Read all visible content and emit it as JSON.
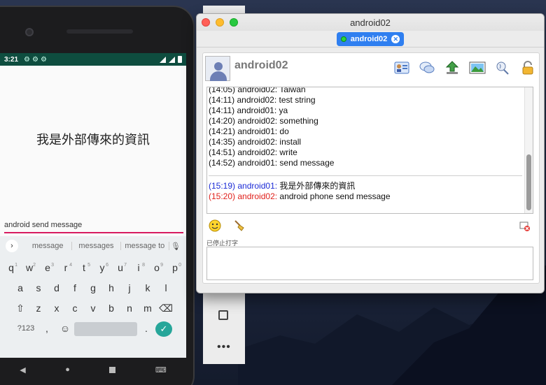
{
  "phone": {
    "status_time": "3:21",
    "app_message": "我是外部傳來的資訊",
    "input_text": "android send message",
    "suggestions": [
      "message",
      "messages",
      "message to"
    ],
    "keys_row1": [
      [
        "q",
        "1"
      ],
      [
        "w",
        "2"
      ],
      [
        "e",
        "3"
      ],
      [
        "r",
        "4"
      ],
      [
        "t",
        "5"
      ],
      [
        "y",
        "6"
      ],
      [
        "u",
        "7"
      ],
      [
        "i",
        "8"
      ],
      [
        "o",
        "9"
      ],
      [
        "p",
        "0"
      ]
    ],
    "keys_row2": [
      "a",
      "s",
      "d",
      "f",
      "g",
      "h",
      "j",
      "k",
      "l"
    ],
    "keys_row3": [
      "z",
      "x",
      "c",
      "v",
      "b",
      "n",
      "m"
    ],
    "key_symbols": "?123",
    "key_comma": ",",
    "key_period": "."
  },
  "window": {
    "title": "android02",
    "tab_label": "android02",
    "contact_name": "android02",
    "history": [
      {
        "time": "(14:05)",
        "sender": "android02",
        "text": "Taiwan"
      },
      {
        "time": "(14:11)",
        "sender": "android02",
        "text": "test string"
      },
      {
        "time": "(14:11)",
        "sender": "android01",
        "text": "ya"
      },
      {
        "time": "(14:20)",
        "sender": "android02",
        "text": "something"
      },
      {
        "time": "(14:21)",
        "sender": "android01",
        "text": "do"
      },
      {
        "time": "(14:35)",
        "sender": "android02",
        "text": "install"
      },
      {
        "time": "(14:51)",
        "sender": "android02",
        "text": "write"
      },
      {
        "time": "(14:52)",
        "sender": "android01",
        "text": "send message"
      }
    ],
    "recent": [
      {
        "time": "(15:19)",
        "sender": "android01",
        "text": "我是外部傳來的資訊",
        "color": "#1b2bd6"
      },
      {
        "time": "(15:20)",
        "sender": "android02",
        "text": "android phone send message",
        "color": "#e0201b"
      }
    ],
    "typing_status": "已停止打字"
  },
  "colors": {
    "tab_blue": "#2f7ff0",
    "sent_blue": "#1b2bd6",
    "received_red": "#e0201b",
    "android_statusbar": "#0e4d3f",
    "input_underline": "#d81b60"
  },
  "icons": [
    "contact-card-icon",
    "chat-bubbles-icon",
    "send-file-icon",
    "image-icon",
    "voice-icon",
    "lock-icon",
    "smiley-icon",
    "broom-icon",
    "clear-icon"
  ]
}
